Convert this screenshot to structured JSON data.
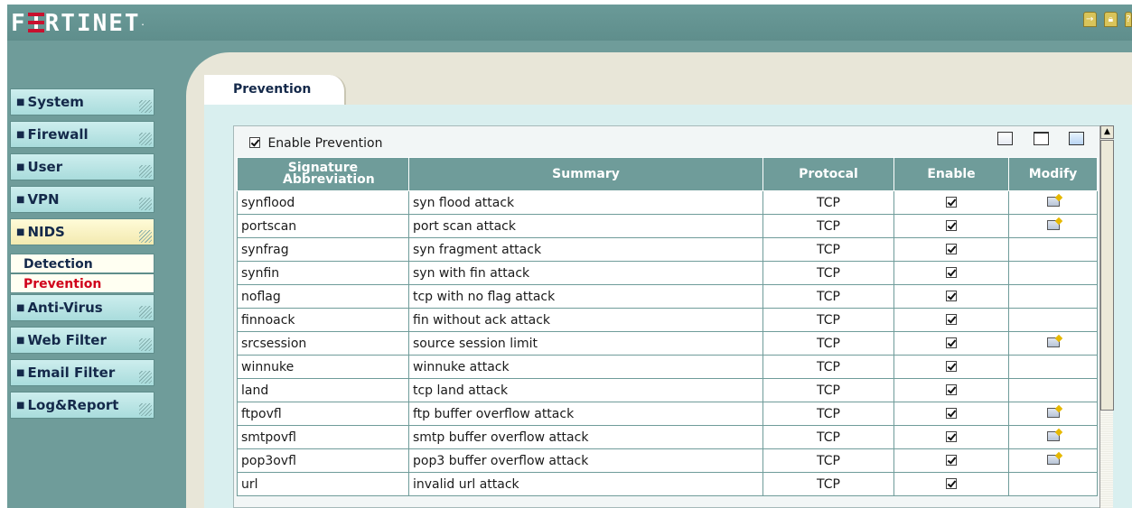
{
  "brand": {
    "logo_left": "F",
    "logo_right": "RTINET",
    "trademark": "."
  },
  "topbar": {
    "icons": [
      "logout-icon",
      "lock-icon",
      "help-icon"
    ]
  },
  "nav": {
    "items": [
      {
        "label": "System",
        "active": false
      },
      {
        "label": "Firewall",
        "active": false
      },
      {
        "label": "User",
        "active": false
      },
      {
        "label": "VPN",
        "active": false
      },
      {
        "label": "NIDS",
        "active": true
      },
      {
        "label": "Anti-Virus",
        "active": false
      },
      {
        "label": "Web Filter",
        "active": false
      },
      {
        "label": "Email Filter",
        "active": false
      },
      {
        "label": "Log&Report",
        "active": false
      }
    ],
    "sub_items": [
      {
        "label": "Detection",
        "active": false
      },
      {
        "label": "Prevention",
        "active": true
      }
    ]
  },
  "page": {
    "tab_label": "Prevention",
    "enable_label": "Enable Prevention",
    "enable_checked": true
  },
  "table": {
    "headers": [
      "Signature Abbreviation",
      "Summary",
      "Protocal",
      "Enable",
      "Modify"
    ],
    "rows": [
      {
        "sig": "synflood",
        "summary": "syn flood attack",
        "protocol": "TCP",
        "enable": true,
        "modify": true
      },
      {
        "sig": "portscan",
        "summary": "port scan attack",
        "protocol": "TCP",
        "enable": true,
        "modify": true
      },
      {
        "sig": "synfrag",
        "summary": "syn fragment attack",
        "protocol": "TCP",
        "enable": true,
        "modify": false
      },
      {
        "sig": "synfin",
        "summary": "syn with fin attack",
        "protocol": "TCP",
        "enable": true,
        "modify": false
      },
      {
        "sig": "noflag",
        "summary": "tcp with no flag attack",
        "protocol": "TCP",
        "enable": true,
        "modify": false
      },
      {
        "sig": "finnoack",
        "summary": "fin without ack attack",
        "protocol": "TCP",
        "enable": true,
        "modify": false
      },
      {
        "sig": "srcsession",
        "summary": "source session limit",
        "protocol": "TCP",
        "enable": true,
        "modify": true
      },
      {
        "sig": "winnuke",
        "summary": "winnuke attack",
        "protocol": "TCP",
        "enable": true,
        "modify": false
      },
      {
        "sig": "land",
        "summary": "tcp land attack",
        "protocol": "TCP",
        "enable": true,
        "modify": false
      },
      {
        "sig": "ftpovfl",
        "summary": "ftp buffer overflow attack",
        "protocol": "TCP",
        "enable": true,
        "modify": true
      },
      {
        "sig": "smtpovfl",
        "summary": "smtp buffer overflow attack",
        "protocol": "TCP",
        "enable": true,
        "modify": true
      },
      {
        "sig": "pop3ovfl",
        "summary": "pop3 buffer overflow attack",
        "protocol": "TCP",
        "enable": true,
        "modify": true
      },
      {
        "sig": "url",
        "summary": "invalid url attack",
        "protocol": "TCP",
        "enable": true,
        "modify": false
      }
    ]
  },
  "colors": {
    "accent": "#6f9c9a",
    "nav_button": "#bfe7e7",
    "nav_active": "#f7f0c0",
    "sub_active_text": "#d0021b",
    "content_bg": "#d9efef"
  }
}
